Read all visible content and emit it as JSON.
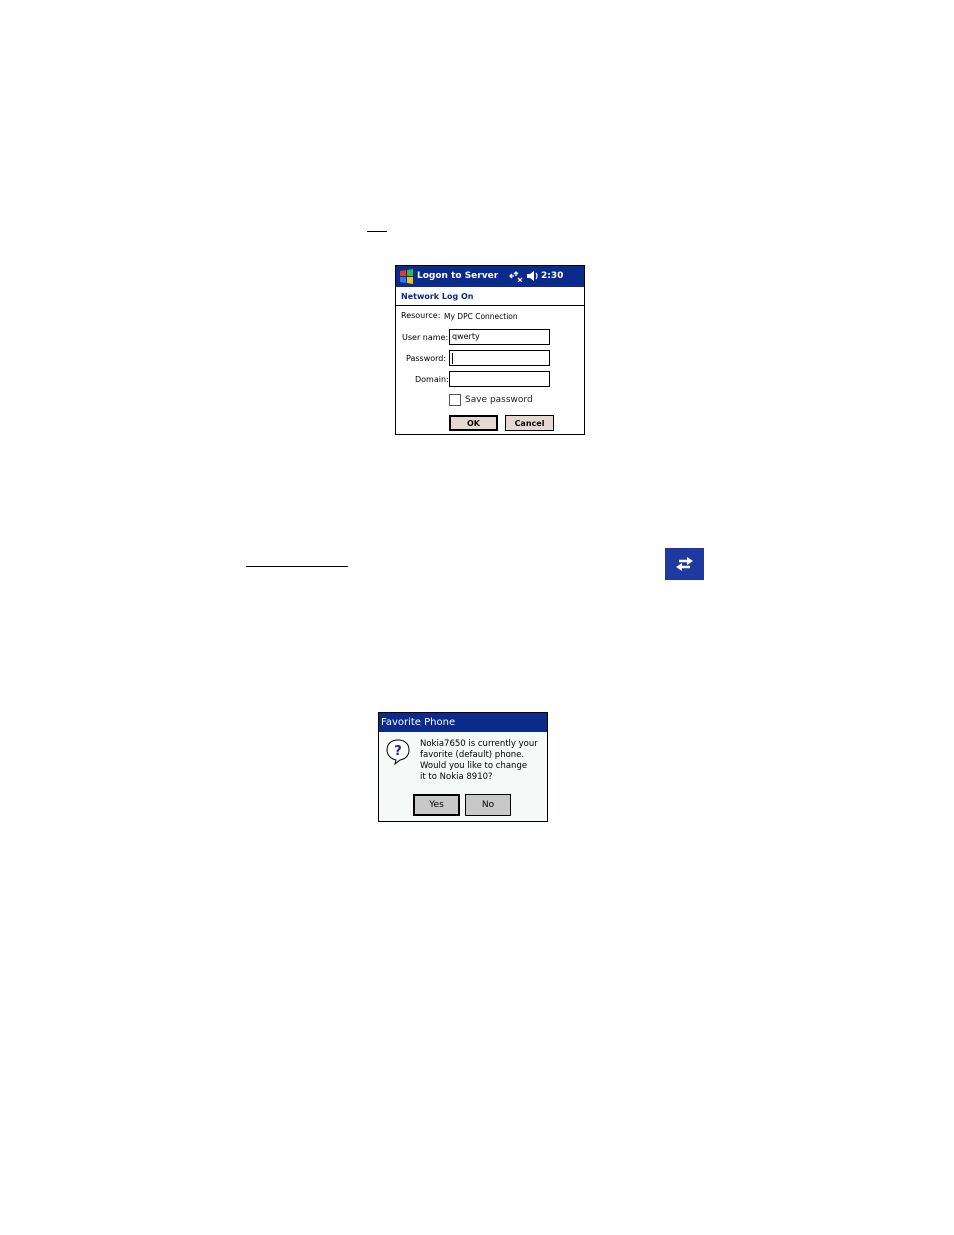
{
  "logon_window": {
    "title": "Logon to Server",
    "clock": "2:30",
    "header": "Network Log On",
    "resource_label": "Resource:",
    "resource_value": "My DPC Connection",
    "username_label": "User name:",
    "username_value": "qwerty",
    "password_label": "Password:",
    "password_value": "",
    "domain_label": "Domain:",
    "domain_value": "",
    "save_password_label": "Save password",
    "save_password_checked": false,
    "ok_label": "OK",
    "cancel_label": "Cancel",
    "icons": [
      "windows-flag-icon",
      "connectivity-icon",
      "volume-icon"
    ]
  },
  "sync_icon": {
    "icon": "sync-arrows-icon",
    "color": "#1f3a9e"
  },
  "favorite_dialog": {
    "title": "Favorite Phone",
    "message_lines": [
      "Nokia7650 is currently your",
      "favorite (default) phone.",
      "Would you like to change",
      "it to Nokia 8910?"
    ],
    "yes_label": "Yes",
    "no_label": "No",
    "icon": "question-icon"
  },
  "colors": {
    "titlebar": "#0a2a8c",
    "button_face": "#e6d8d0",
    "dialog_button": "#c8c8c8"
  }
}
